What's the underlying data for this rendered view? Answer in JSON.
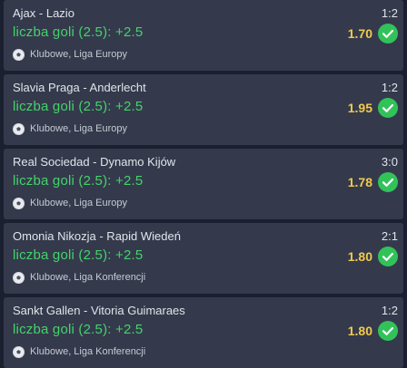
{
  "bets": [
    {
      "teams": "Ajax - Lazio",
      "score": "1:2",
      "market": "liczba goli (2.5): +2.5",
      "odds": "1.70",
      "league": "Klubowe, Liga Europy",
      "status_icon": "check-circle-icon",
      "sport_icon": "football-icon"
    },
    {
      "teams": "Slavia Praga - Anderlecht",
      "score": "1:2",
      "market": "liczba goli (2.5): +2.5",
      "odds": "1.95",
      "league": "Klubowe, Liga Europy",
      "status_icon": "check-circle-icon",
      "sport_icon": "football-icon"
    },
    {
      "teams": "Real Sociedad - Dynamo Kijów",
      "score": "3:0",
      "market": "liczba goli (2.5): +2.5",
      "odds": "1.78",
      "league": "Klubowe, Liga Europy",
      "status_icon": "check-circle-icon",
      "sport_icon": "football-icon"
    },
    {
      "teams": "Omonia Nikozja - Rapid Wiedeń",
      "score": "2:1",
      "market": "liczba goli (2.5): +2.5",
      "odds": "1.80",
      "league": "Klubowe, Liga Konferencji",
      "status_icon": "check-circle-icon",
      "sport_icon": "football-icon"
    },
    {
      "teams": "Sankt Gallen - Vitoria Guimaraes",
      "score": "1:2",
      "market": "liczba goli (2.5): +2.5",
      "odds": "1.80",
      "league": "Klubowe, Liga Konferencji",
      "status_icon": "check-circle-icon",
      "sport_icon": "football-icon"
    }
  ],
  "colors": {
    "background": "#1b2030",
    "card": "#343a4c",
    "market_green": "#44d36a",
    "odds_yellow": "#f2c94c",
    "won_green": "#32c25a"
  }
}
